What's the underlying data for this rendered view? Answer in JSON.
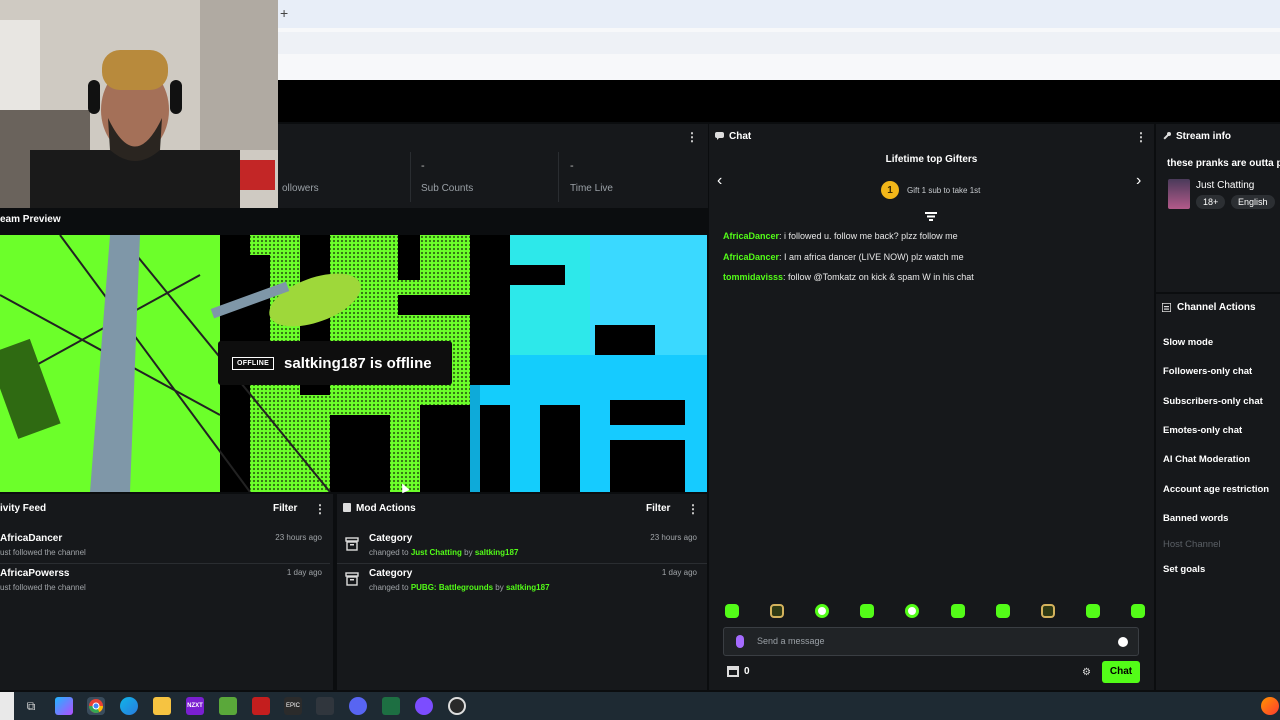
{
  "browser": {
    "new_tab_label": "+"
  },
  "stats": {
    "items": [
      {
        "value": "",
        "label": "ollowers"
      },
      {
        "value": "-",
        "label": "Sub Counts"
      },
      {
        "value": "-",
        "label": "Time Live"
      }
    ]
  },
  "preview": {
    "title": "eam Preview",
    "offline_badge": "OFFLINE",
    "offline_text": "saltking187 is offline",
    "art_text": "OFF-LINE"
  },
  "activity_feed": {
    "title": "ivity Feed",
    "filter_label": "Filter",
    "items": [
      {
        "name": "AfricaDancer",
        "sub": "ust followed the channel",
        "time": "23 hours ago"
      },
      {
        "name": "AfricaPowerss",
        "sub": "ust followed the channel",
        "time": "1 day ago"
      }
    ]
  },
  "mod_actions": {
    "title": "Mod Actions",
    "filter_label": "Filter",
    "items": [
      {
        "title": "Category",
        "prefix": "changed to ",
        "value": "Just Chatting",
        "by": " by ",
        "user": "saltking187",
        "time": "23 hours ago"
      },
      {
        "title": "Category",
        "prefix": "changed to ",
        "value": "PUBG: Battlegrounds",
        "by": " by ",
        "user": "saltking187",
        "time": "1 day ago"
      }
    ]
  },
  "chat": {
    "title": "Chat",
    "gifters_title": "Lifetime top Gifters",
    "gift_rank": "1",
    "gift_text": "Gift 1 sub to take 1st",
    "messages": [
      {
        "user": "AfricaDancer",
        "text": ": i followed u. follow me back? plzz follow me"
      },
      {
        "user": "AfricaDancer",
        "text": ": I am africa dancer (LIVE NOW) plz watch me"
      },
      {
        "user": "tommidavisss",
        "text": ": follow @Tomkatz on kick & spam W in his chat"
      }
    ],
    "input_placeholder": "Send a message",
    "points": "0",
    "send_label": "Chat"
  },
  "stream_info": {
    "title": "Stream info",
    "stream_title": "these pranks are outta po",
    "category": "Just Chatting",
    "tags": [
      "18+",
      "English"
    ]
  },
  "channel_actions": {
    "title": "Channel Actions",
    "items": [
      {
        "label": "Slow mode",
        "enabled": true
      },
      {
        "label": "Followers-only chat",
        "enabled": true
      },
      {
        "label": "Subscribers-only chat",
        "enabled": true
      },
      {
        "label": "Emotes-only chat",
        "enabled": true
      },
      {
        "label": "AI Chat Moderation",
        "enabled": true
      },
      {
        "label": "Account age restriction",
        "enabled": true
      },
      {
        "label": "Banned words",
        "enabled": true
      },
      {
        "label": "Host Channel",
        "enabled": false
      },
      {
        "label": "Set goals",
        "enabled": true
      }
    ]
  },
  "taskbar": {
    "apps": [
      "windows-start",
      "task-view",
      "copilot",
      "chrome",
      "edge",
      "file-explorer",
      "nzxt",
      "minecraft",
      "red-app",
      "epic-games",
      "unity",
      "discord",
      "excel",
      "purple-app",
      "obs-studio",
      "browser-extra"
    ]
  },
  "colors": {
    "accent": "#53fc18",
    "panel": "#16181b",
    "background": "#0b0d0f"
  }
}
